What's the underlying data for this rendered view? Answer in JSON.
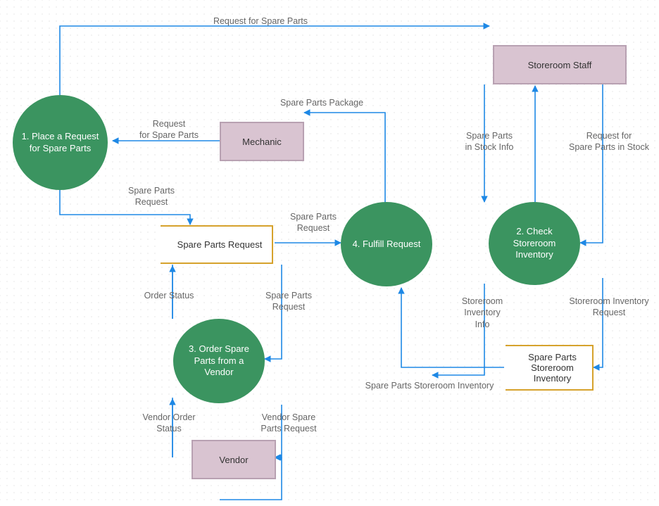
{
  "processes": {
    "p1": "1. Place a Request for Spare Parts",
    "p2": "2. Check Storeroom Inventory",
    "p3": "3. Order Spare Parts from a Vendor",
    "p4": "4. Fulfill Request"
  },
  "entities": {
    "mechanic": "Mechanic",
    "storeroom_staff": "Storeroom Staff",
    "vendor": "Vendor"
  },
  "datastores": {
    "spare_parts_request": "Spare Parts Request",
    "spare_parts_storeroom_inventory": "Spare Parts Storeroom Inventory"
  },
  "flows": {
    "request_for_spare_parts_top": "Request for Spare Parts",
    "request_for_spare_parts_mech": "Request\nfor Spare Parts",
    "spare_parts_package": "Spare Parts Package",
    "spare_parts_in_stock_info": "Spare Parts\nin Stock Info",
    "request_for_spare_parts_in_stock": "Request for\nSpare Parts in Stock",
    "spare_parts_request_down": "Spare Parts\nRequest",
    "spare_parts_request_to_fulfill": "Spare Parts\nRequest",
    "order_status": "Order  Status",
    "spare_parts_request_to_order": "Spare Parts\nRequest",
    "vendor_order_status": "Vendor Order\nStatus",
    "vendor_spare_parts_request": "Vendor Spare\nParts Request",
    "storeroom_inventory_info": "Storeroom\nInventory\nInfo",
    "storeroom_inventory_request": "Storeroom Inventory\nRequest",
    "spare_parts_storeroom_inventory_lbl": "Spare Parts Storeroom Inventory"
  }
}
